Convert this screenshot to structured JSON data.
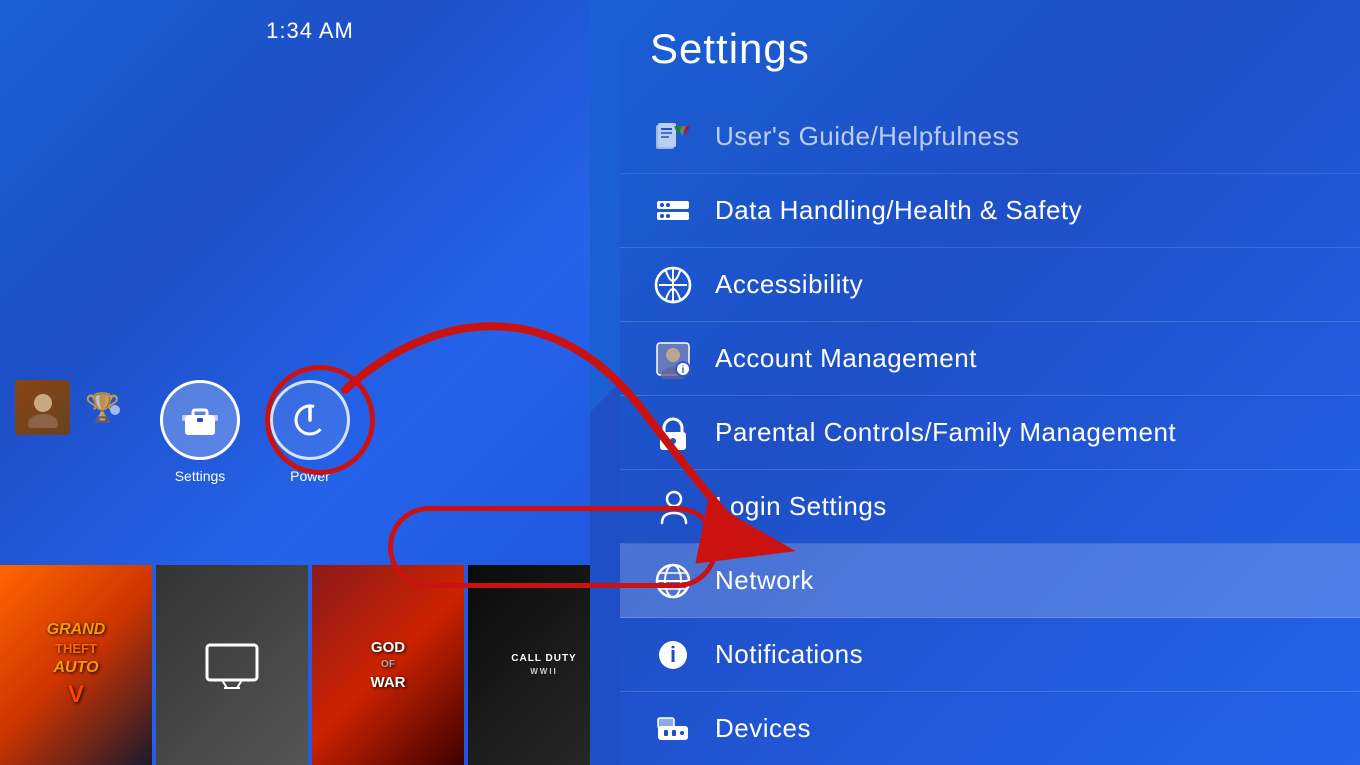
{
  "time": "1:34 AM",
  "left_panel": {
    "quick_menu": [
      {
        "label": "Settings",
        "icon": "🧰"
      },
      {
        "label": "Power",
        "icon": "⏻"
      }
    ],
    "game_thumbnails": [
      {
        "id": "gta",
        "label": "Grand Theft Auto V"
      },
      {
        "id": "tv",
        "label": "TV"
      },
      {
        "id": "gow",
        "label": "God of War"
      },
      {
        "id": "cod",
        "label": "Call of Duty WWII"
      }
    ]
  },
  "right_panel": {
    "title": "Settings",
    "menu_items": [
      {
        "id": "user-guide",
        "label": "User's Guide/Helpfulness",
        "icon": "📖"
      },
      {
        "id": "data-handling",
        "label": "Data Handling/Health & Safety",
        "icon": "🗂"
      },
      {
        "id": "accessibility",
        "label": "Accessibility",
        "icon": "♿"
      },
      {
        "id": "account-management",
        "label": "Account Management",
        "icon": "👤"
      },
      {
        "id": "parental-controls",
        "label": "Parental Controls/Family Management",
        "icon": "🔒"
      },
      {
        "id": "login-settings",
        "label": "Login Settings",
        "icon": "🔑"
      },
      {
        "id": "network",
        "label": "Network",
        "icon": "🌐",
        "active": true
      },
      {
        "id": "notifications",
        "label": "Notifications",
        "icon": "ℹ"
      },
      {
        "id": "devices",
        "label": "Devices",
        "icon": "🎮"
      }
    ]
  },
  "annotations": {
    "arrow_color": "#cc1111",
    "circle_color": "#cc1111"
  }
}
